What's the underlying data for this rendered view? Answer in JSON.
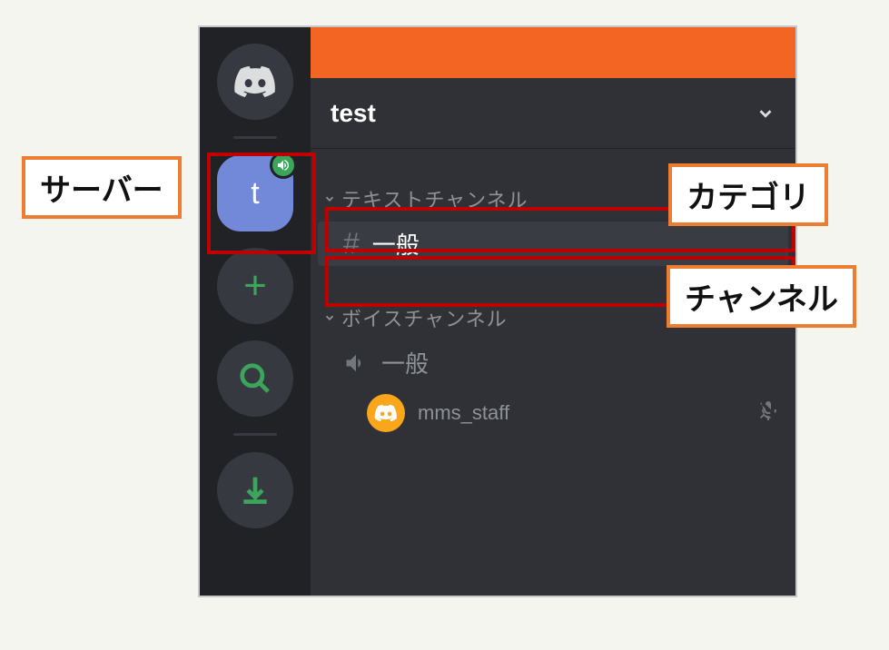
{
  "server": {
    "label": "t",
    "name": "test"
  },
  "categories": [
    {
      "name": "テキストチャンネル",
      "channels": [
        {
          "name": "一般",
          "selected": true,
          "type": "text"
        }
      ]
    },
    {
      "name": "ボイスチャンネル",
      "channels": [
        {
          "name": "一般",
          "type": "voice",
          "users": [
            {
              "name": "mms_staff",
              "muted": true
            }
          ]
        }
      ]
    }
  ],
  "callouts": {
    "server": "サーバー",
    "category": "カテゴリ",
    "channel": "チャンネル"
  }
}
